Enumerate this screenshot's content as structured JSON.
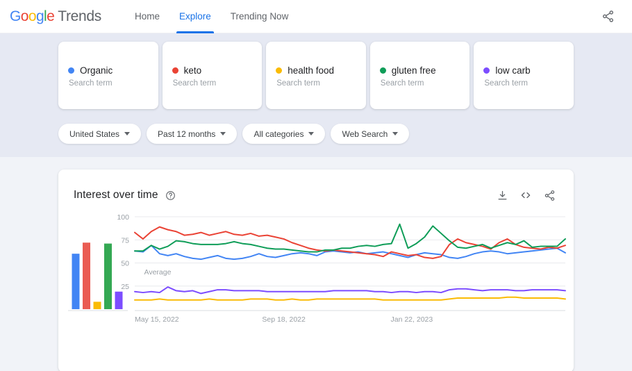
{
  "header": {
    "logo_text": "Google",
    "logo_letters": [
      "G",
      "o",
      "o",
      "g",
      "l",
      "e"
    ],
    "brand_word": "Trends",
    "nav": [
      {
        "label": "Home",
        "active": false
      },
      {
        "label": "Explore",
        "active": true
      },
      {
        "label": "Trending Now",
        "active": false
      }
    ],
    "share_icon": "share-icon"
  },
  "terms": [
    {
      "name": "Organic",
      "type": "Search term",
      "color": "#4285F4"
    },
    {
      "name": "keto",
      "type": "Search term",
      "color": "#EA4335"
    },
    {
      "name": "health food",
      "type": "Search term",
      "color": "#FABB05"
    },
    {
      "name": "gluten free",
      "type": "Search term",
      "color": "#0F9D58"
    },
    {
      "name": "low carb",
      "type": "Search term",
      "color": "#7C4DFF"
    }
  ],
  "filters": [
    {
      "label": "United States",
      "icon": "chevron-down-icon"
    },
    {
      "label": "Past 12 months",
      "icon": "chevron-down-icon"
    },
    {
      "label": "All categories",
      "icon": "chevron-down-icon"
    },
    {
      "label": "Web Search",
      "icon": "chevron-down-icon"
    }
  ],
  "chart_card": {
    "title": "Interest over time",
    "help_icon": "help-circle-icon",
    "actions": [
      {
        "name": "download-icon",
        "label": "Download CSV"
      },
      {
        "name": "embed-code-icon",
        "label": "Embed"
      },
      {
        "name": "share-icon",
        "label": "Share"
      }
    ],
    "average_label": "Average"
  },
  "chart_data": {
    "type": "line",
    "title": "Interest over time",
    "xlabel": "",
    "ylabel": "",
    "ylim": [
      0,
      100
    ],
    "yticks": [
      25,
      50,
      75,
      100
    ],
    "grid": true,
    "legend": "none",
    "xtick_labels": [
      "May 15, 2022",
      "Sep 18, 2022",
      "Jan 22, 2023"
    ],
    "xtick_positions": [
      0,
      18,
      36
    ],
    "n_points": 53,
    "series": [
      {
        "name": "Organic",
        "color": "#4285F4",
        "values": [
          63,
          62,
          69,
          60,
          58,
          60,
          57,
          55,
          54,
          56,
          58,
          55,
          54,
          55,
          57,
          60,
          57,
          56,
          58,
          60,
          61,
          60,
          58,
          62,
          63,
          62,
          61,
          62,
          60,
          61,
          62,
          60,
          58,
          56,
          59,
          61,
          60,
          59,
          56,
          55,
          57,
          60,
          62,
          63,
          62,
          60,
          61,
          62,
          63,
          64,
          65,
          66,
          61
        ]
      },
      {
        "name": "keto",
        "color": "#EA4335",
        "values": [
          83,
          76,
          84,
          89,
          86,
          84,
          80,
          81,
          83,
          80,
          82,
          84,
          81,
          80,
          82,
          79,
          80,
          78,
          76,
          72,
          69,
          66,
          64,
          63,
          64,
          63,
          62,
          61,
          60,
          59,
          57,
          62,
          60,
          58,
          59,
          56,
          55,
          57,
          70,
          76,
          72,
          70,
          68,
          65,
          72,
          76,
          70,
          67,
          66,
          65,
          67,
          66,
          69
        ]
      },
      {
        "name": "health food",
        "color": "#FABB05",
        "values": [
          10,
          10,
          10,
          11,
          10,
          10,
          10,
          10,
          10,
          11,
          10,
          10,
          10,
          10,
          11,
          11,
          11,
          10,
          10,
          11,
          10,
          10,
          11,
          11,
          11,
          11,
          11,
          11,
          11,
          11,
          10,
          10,
          10,
          10,
          10,
          10,
          10,
          10,
          11,
          12,
          12,
          12,
          12,
          12,
          12,
          13,
          13,
          12,
          12,
          12,
          12,
          12,
          11
        ]
      },
      {
        "name": "gluten free",
        "color": "#0F9D58",
        "values": [
          63,
          63,
          69,
          65,
          68,
          74,
          73,
          71,
          70,
          70,
          70,
          71,
          73,
          71,
          70,
          68,
          66,
          65,
          65,
          64,
          63,
          62,
          62,
          64,
          64,
          66,
          66,
          68,
          69,
          68,
          70,
          71,
          92,
          66,
          71,
          78,
          90,
          82,
          74,
          67,
          66,
          68,
          70,
          66,
          69,
          72,
          70,
          74,
          67,
          68,
          68,
          68,
          76
        ]
      },
      {
        "name": "low carb",
        "color": "#7C4DFF",
        "values": [
          19,
          18,
          19,
          18,
          24,
          20,
          19,
          20,
          17,
          19,
          21,
          21,
          20,
          20,
          20,
          20,
          19,
          19,
          19,
          19,
          19,
          19,
          19,
          19,
          20,
          20,
          20,
          20,
          20,
          19,
          19,
          18,
          19,
          19,
          18,
          19,
          19,
          18,
          21,
          22,
          22,
          21,
          20,
          21,
          21,
          21,
          20,
          20,
          21,
          21,
          21,
          21,
          20
        ]
      }
    ],
    "average_bars": {
      "label": "Average",
      "categories": [
        "Organic",
        "keto",
        "health food",
        "gluten free",
        "low carb"
      ],
      "values": [
        60,
        72,
        8,
        71,
        19
      ],
      "colors": [
        "#4285F4",
        "#EA5C52",
        "#FABB05",
        "#34A853",
        "#7C4DFF"
      ]
    }
  }
}
